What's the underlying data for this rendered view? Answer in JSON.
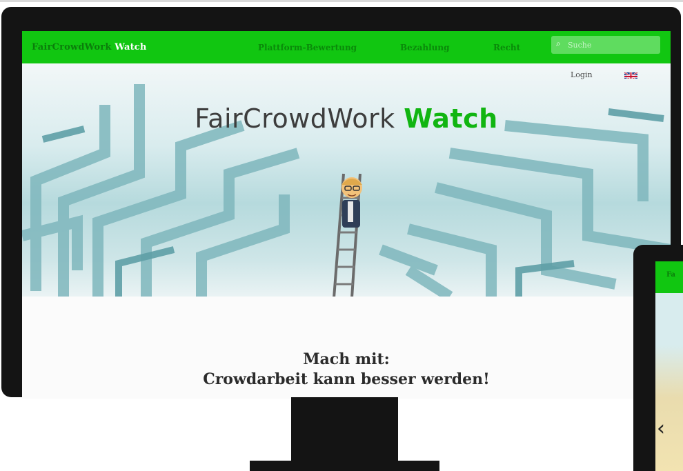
{
  "site": {
    "brand_prefix": "FairCrowdWork",
    "brand_accent": "Watch"
  },
  "nav": {
    "links": [
      "Plattform-Bewertung",
      "Bezahlung",
      "Recht"
    ]
  },
  "search": {
    "placeholder": "Suche"
  },
  "utility": {
    "login": "Login",
    "language_flag": "uk-flag-icon"
  },
  "hero": {
    "title_prefix": "FairCrowdWork",
    "title_accent": "Watch"
  },
  "content": {
    "cta_line1": "Mach mit:",
    "cta_line2": "Crowdarbeit kann besser werden!"
  },
  "tablet": {
    "brand_fragment": "Fa",
    "carousel_prev": "‹"
  },
  "colors": {
    "accent_green": "#11c611",
    "device_frame": "#141414"
  }
}
